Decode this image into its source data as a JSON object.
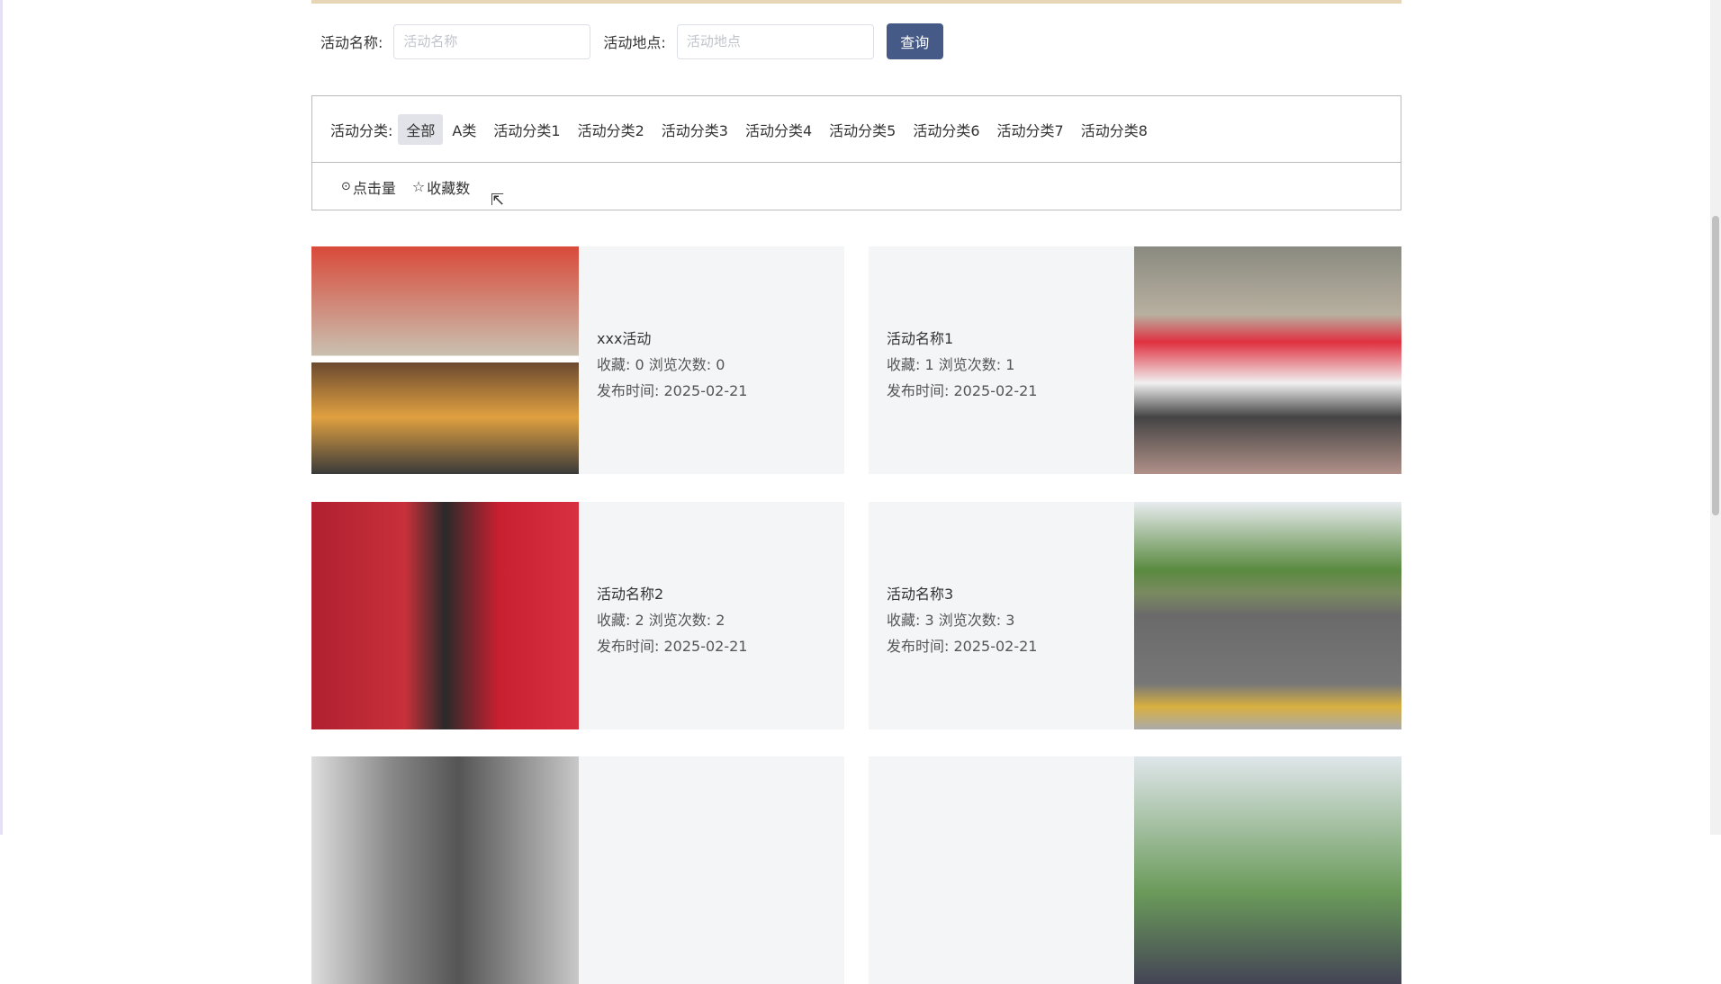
{
  "search": {
    "name_label": "活动名称:",
    "name_placeholder": "活动名称",
    "place_label": "活动地点:",
    "place_placeholder": "活动地点",
    "button": "查询"
  },
  "categories": {
    "label": "活动分类:",
    "items": [
      "全部",
      "A类",
      "活动分类1",
      "活动分类2",
      "活动分类3",
      "活动分类4",
      "活动分类5",
      "活动分类6",
      "活动分类7",
      "活动分类8"
    ]
  },
  "sort": {
    "clicks": "点击量",
    "favorites": "收藏数"
  },
  "cards": [
    {
      "title": "xxx活动",
      "stats": "收藏: 0  浏览次数: 0",
      "date": "发布时间: 2025-02-21"
    },
    {
      "title": "活动名称1",
      "stats": "收藏: 1  浏览次数: 1",
      "date": "发布时间: 2025-02-21"
    },
    {
      "title": "活动名称2",
      "stats": "收藏: 2  浏览次数: 2",
      "date": "发布时间: 2025-02-21"
    },
    {
      "title": "活动名称3",
      "stats": "收藏: 3  浏览次数: 3",
      "date": "发布时间: 2025-02-21"
    }
  ]
}
